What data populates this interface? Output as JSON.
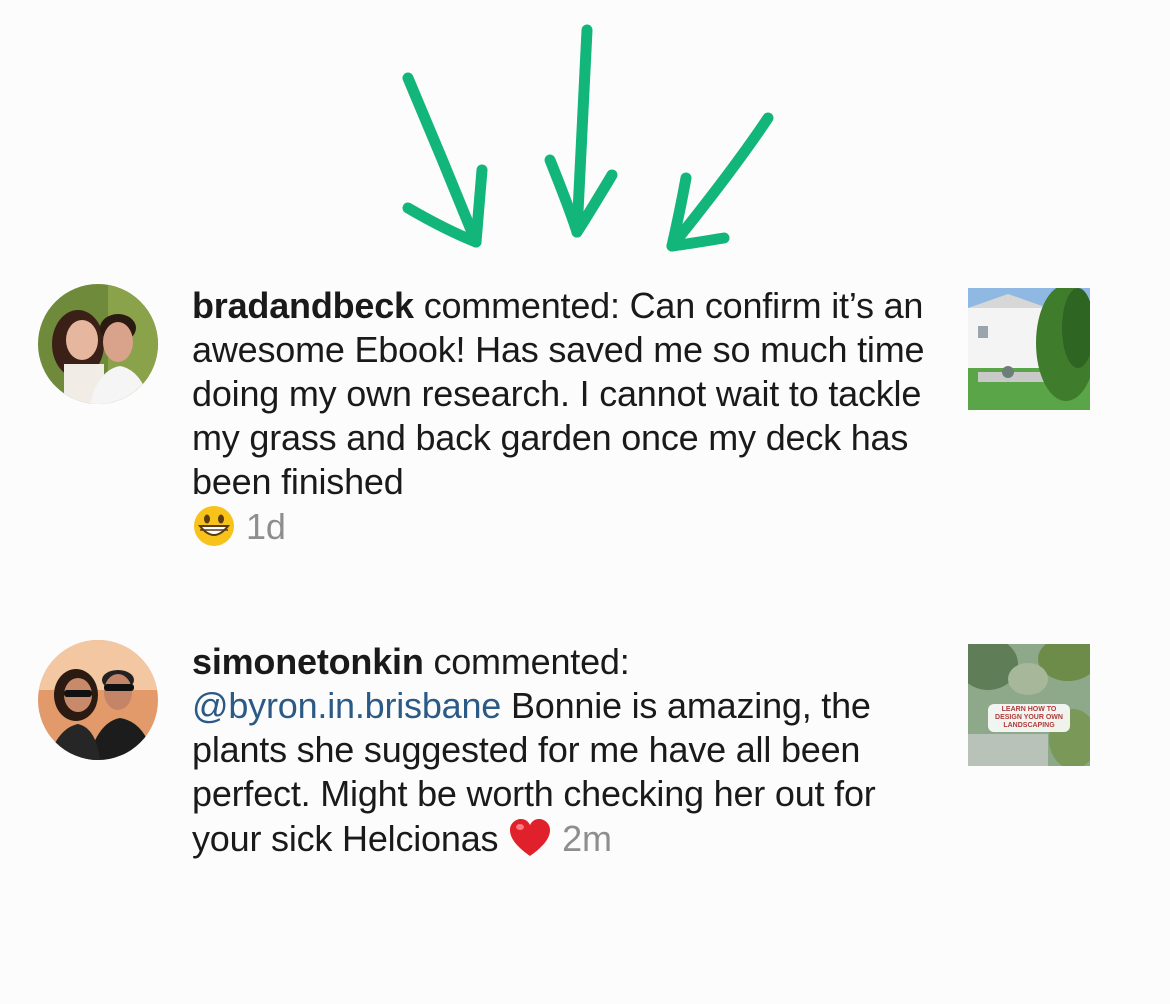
{
  "comments": [
    {
      "username": "bradandbeck",
      "action": "commented:",
      "text": "Can confirm it’s an awesome Ebook! Has saved me so much time doing my own research. I cannot wait to tackle my grass and back garden once my deck has been finished",
      "emoji": "grinning-face-emoji",
      "timestamp": "1d"
    },
    {
      "username": "simonetonkin",
      "action": "commented:",
      "mention": "@byron.in.brisbane",
      "text": "Bonnie is amazing, the plants she suggested for me have all been perfect. Might be worth checking her out for your sick Helcionas",
      "emoji": "red-heart-emoji",
      "timestamp": "2m",
      "thumb_label": "LEARN HOW TO DESIGN YOUR OWN LANDSCAPING"
    }
  ],
  "colors": {
    "arrow": "#12b57a",
    "mention": "#2b5a86",
    "timestamp": "#8e8e8e"
  }
}
